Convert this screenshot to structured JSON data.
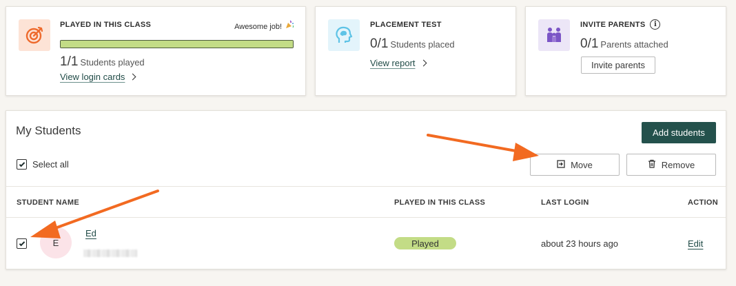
{
  "played_card": {
    "title": "PLAYED IN THIS CLASS",
    "badge": "Awesome job!",
    "badge_icon": "party-popper-icon",
    "icon": "target-icon",
    "progress_fraction": 1,
    "count": "1/1",
    "count_label": "Students played",
    "link": "View login cards"
  },
  "placement_card": {
    "title": "PLACEMENT TEST",
    "icon": "brain-head-icon",
    "count": "0/1",
    "count_label": "Students placed",
    "link": "View report"
  },
  "parents_card": {
    "title": "INVITE PARENTS",
    "icon": "family-icon",
    "info_icon": "info-icon",
    "count": "0/1",
    "count_label": "Parents attached",
    "button": "Invite parents"
  },
  "students": {
    "heading": "My Students",
    "add_button": "Add students",
    "select_all": "Select all",
    "select_all_checked": true,
    "move_button": "Move",
    "remove_button": "Remove",
    "columns": [
      "STUDENT NAME",
      "PLAYED IN THIS CLASS",
      "LAST LOGIN",
      "ACTION"
    ],
    "rows": [
      {
        "checked": true,
        "initial": "E",
        "name": "Ed",
        "status": "Played",
        "last_login": "about 23 hours ago",
        "action": "Edit"
      }
    ]
  },
  "colors": {
    "page_bg": "#f7f5f1",
    "primary": "#24514c",
    "progress": "#c3dc86",
    "annotation_arrow": "#f26a21"
  }
}
